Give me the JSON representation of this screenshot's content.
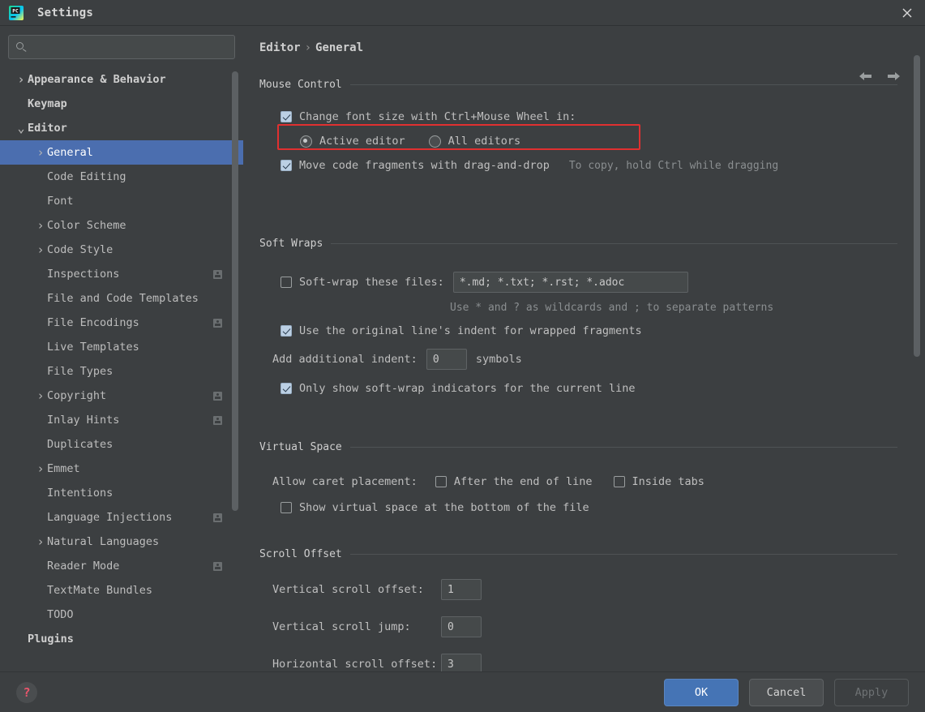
{
  "window": {
    "title": "Settings",
    "app_icon": "pycharm-icon",
    "close_icon": "close-icon"
  },
  "search": {
    "value": "",
    "placeholder": "",
    "icon": "search-icon"
  },
  "sidebar": {
    "items": [
      {
        "label": "Appearance & Behavior",
        "arrow": "right",
        "indent": 0,
        "bold": true,
        "selected": false,
        "badge": false
      },
      {
        "label": "Keymap",
        "arrow": "none",
        "indent": 0,
        "bold": true,
        "selected": false,
        "badge": false
      },
      {
        "label": "Editor",
        "arrow": "down",
        "indent": 0,
        "bold": true,
        "selected": false,
        "badge": false
      },
      {
        "label": "General",
        "arrow": "right",
        "indent": 1,
        "bold": false,
        "selected": true,
        "badge": false
      },
      {
        "label": "Code Editing",
        "arrow": "none",
        "indent": 1,
        "bold": false,
        "selected": false,
        "badge": false
      },
      {
        "label": "Font",
        "arrow": "none",
        "indent": 1,
        "bold": false,
        "selected": false,
        "badge": false
      },
      {
        "label": "Color Scheme",
        "arrow": "right",
        "indent": 1,
        "bold": false,
        "selected": false,
        "badge": false
      },
      {
        "label": "Code Style",
        "arrow": "right",
        "indent": 1,
        "bold": false,
        "selected": false,
        "badge": false
      },
      {
        "label": "Inspections",
        "arrow": "none",
        "indent": 1,
        "bold": false,
        "selected": false,
        "badge": true
      },
      {
        "label": "File and Code Templates",
        "arrow": "none",
        "indent": 1,
        "bold": false,
        "selected": false,
        "badge": false
      },
      {
        "label": "File Encodings",
        "arrow": "none",
        "indent": 1,
        "bold": false,
        "selected": false,
        "badge": true
      },
      {
        "label": "Live Templates",
        "arrow": "none",
        "indent": 1,
        "bold": false,
        "selected": false,
        "badge": false
      },
      {
        "label": "File Types",
        "arrow": "none",
        "indent": 1,
        "bold": false,
        "selected": false,
        "badge": false
      },
      {
        "label": "Copyright",
        "arrow": "right",
        "indent": 1,
        "bold": false,
        "selected": false,
        "badge": true
      },
      {
        "label": "Inlay Hints",
        "arrow": "none",
        "indent": 1,
        "bold": false,
        "selected": false,
        "badge": true
      },
      {
        "label": "Duplicates",
        "arrow": "none",
        "indent": 1,
        "bold": false,
        "selected": false,
        "badge": false
      },
      {
        "label": "Emmet",
        "arrow": "right",
        "indent": 1,
        "bold": false,
        "selected": false,
        "badge": false
      },
      {
        "label": "Intentions",
        "arrow": "none",
        "indent": 1,
        "bold": false,
        "selected": false,
        "badge": false
      },
      {
        "label": "Language Injections",
        "arrow": "none",
        "indent": 1,
        "bold": false,
        "selected": false,
        "badge": true
      },
      {
        "label": "Natural Languages",
        "arrow": "right",
        "indent": 1,
        "bold": false,
        "selected": false,
        "badge": false
      },
      {
        "label": "Reader Mode",
        "arrow": "none",
        "indent": 1,
        "bold": false,
        "selected": false,
        "badge": true
      },
      {
        "label": "TextMate Bundles",
        "arrow": "none",
        "indent": 1,
        "bold": false,
        "selected": false,
        "badge": false
      },
      {
        "label": "TODO",
        "arrow": "none",
        "indent": 1,
        "bold": false,
        "selected": false,
        "badge": false
      },
      {
        "label": "Plugins",
        "arrow": "none",
        "indent": 0,
        "bold": true,
        "selected": false,
        "badge": false
      }
    ]
  },
  "breadcrumb": {
    "root": "Editor",
    "separator": "›",
    "leaf": "General"
  },
  "nav": {
    "back_icon": "arrow-left-icon",
    "forward_icon": "arrow-right-icon"
  },
  "sections": {
    "mouse_control": {
      "title": "Mouse Control",
      "change_font_size": {
        "label": "Change font size with Ctrl+Mouse Wheel in:",
        "checked": true
      },
      "radio_active_editor": {
        "label": "Active editor",
        "selected": true
      },
      "radio_all_editors": {
        "label": "All editors",
        "selected": false
      },
      "move_code_fragments": {
        "label": "Move code fragments with drag-and-drop",
        "checked": true
      },
      "move_code_hint": "To copy, hold Ctrl while dragging"
    },
    "soft_wraps": {
      "title": "Soft Wraps",
      "soft_wrap_files": {
        "label": "Soft-wrap these files:",
        "checked": false,
        "value": "*.md; *.txt; *.rst; *.adoc"
      },
      "wildcard_hint": "Use * and ? as wildcards and ; to separate patterns",
      "original_indent": {
        "label": "Use the original line's indent for wrapped fragments",
        "checked": true
      },
      "additional_indent": {
        "label": "Add additional indent:",
        "value": "0",
        "suffix": "symbols"
      },
      "only_current_line": {
        "label": "Only show soft-wrap indicators for the current line",
        "checked": true
      }
    },
    "virtual_space": {
      "title": "Virtual Space",
      "allow_caret_label": "Allow caret placement:",
      "after_end_of_line": {
        "label": "After the end of line",
        "checked": false
      },
      "inside_tabs": {
        "label": "Inside tabs",
        "checked": false
      },
      "show_virtual_space": {
        "label": "Show virtual space at the bottom of the file",
        "checked": false
      }
    },
    "scroll_offset": {
      "title": "Scroll Offset",
      "vertical_scroll_offset": {
        "label": "Vertical scroll offset:",
        "value": "1"
      },
      "vertical_scroll_jump": {
        "label": "Vertical scroll jump:",
        "value": "0"
      },
      "horizontal_scroll_offset": {
        "label": "Horizontal scroll offset:",
        "value": "3"
      }
    }
  },
  "footer": {
    "help_icon": "help-icon",
    "ok": "OK",
    "cancel": "Cancel",
    "apply": "Apply"
  },
  "colors": {
    "selection": "#4b6eaf",
    "primary_button": "#4574b5",
    "highlight_box": "#e03030",
    "background": "#3c3f41"
  }
}
